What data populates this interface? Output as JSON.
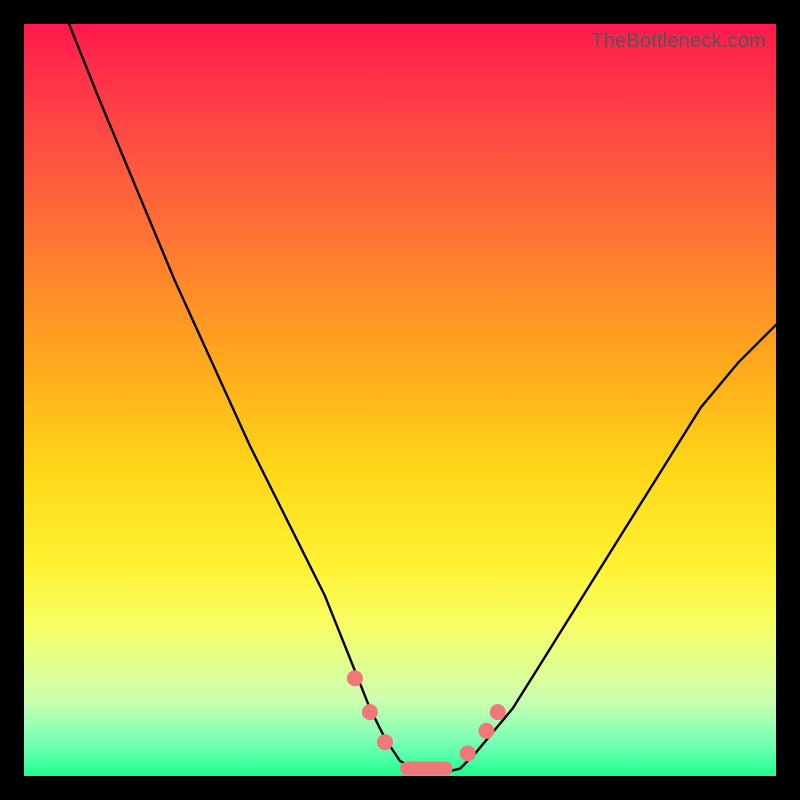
{
  "watermark": "TheBottleneck.com",
  "chart_data": {
    "type": "line",
    "title": "",
    "xlabel": "",
    "ylabel": "",
    "xlim": [
      0,
      100
    ],
    "ylim": [
      0,
      100
    ],
    "series": [
      {
        "name": "curve",
        "x": [
          6,
          10,
          15,
          20,
          25,
          30,
          35,
          40,
          44,
          46,
          48,
          50,
          52,
          54,
          56,
          58,
          60,
          65,
          70,
          75,
          80,
          85,
          90,
          95,
          100
        ],
        "y": [
          100,
          90,
          78,
          66,
          55,
          44,
          34,
          24,
          14,
          9,
          5,
          2,
          1,
          0.5,
          0.5,
          1,
          3,
          9,
          17,
          25,
          33,
          41,
          49,
          55,
          60
        ]
      }
    ],
    "markers": [
      {
        "name": "left-upper-dot",
        "x": 44.0,
        "y": 13.0
      },
      {
        "name": "left-mid-dot",
        "x": 46.0,
        "y": 8.5
      },
      {
        "name": "left-lower-dot",
        "x": 48.0,
        "y": 4.5
      },
      {
        "name": "flat-bar",
        "type": "bar",
        "x0": 50.0,
        "x1": 57.0,
        "y": 1.0
      },
      {
        "name": "right-low-dot",
        "x": 59.0,
        "y": 3.0
      },
      {
        "name": "right-high-dot",
        "x": 61.5,
        "y": 6.0
      },
      {
        "name": "right-top-dot",
        "x": 63.0,
        "y": 8.5
      }
    ],
    "colors": {
      "curve": "#000000",
      "markers": "#f07878",
      "gradient_top": "#ff1a4d",
      "gradient_bottom": "#1fff8f"
    }
  }
}
